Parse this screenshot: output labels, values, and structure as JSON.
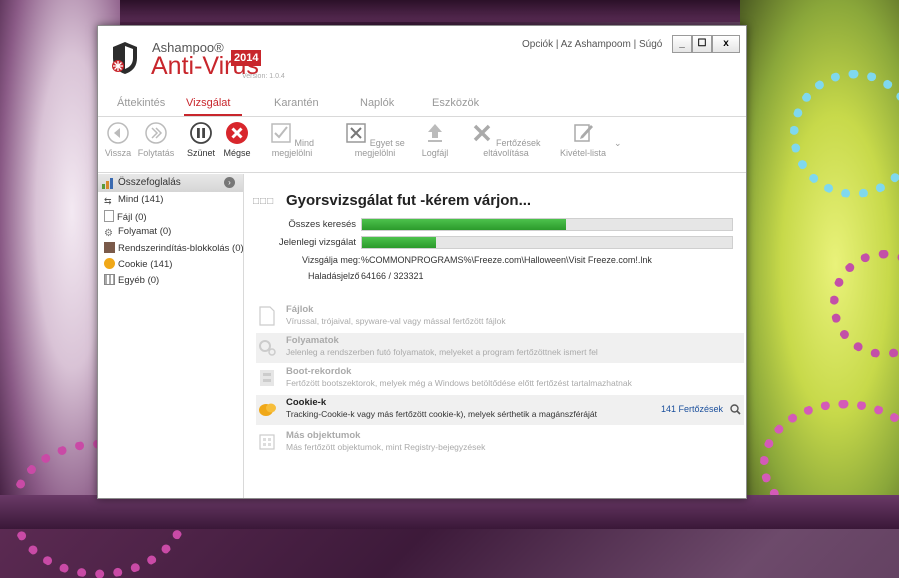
{
  "brand": {
    "company": "Ashampoo®",
    "product": "Anti-Virus",
    "year": "2014",
    "version": "Version: 1.0.4"
  },
  "toplinks": {
    "options": "Opciók",
    "about": "Az Ashampoom",
    "help": "Súgó",
    "sep": "|"
  },
  "window_buttons": {
    "minimize": "_",
    "maximize": "☐",
    "close": "x"
  },
  "tabs": [
    {
      "label": "Áttekintés"
    },
    {
      "label": "Vizsgálat"
    },
    {
      "label": "Karantén"
    },
    {
      "label": "Naplók"
    },
    {
      "label": "Eszközök"
    }
  ],
  "toolbar": {
    "back": "Vissza",
    "resume": "Folytatás",
    "pause": "Szünet",
    "cancel": "Mégse",
    "select_all": "Mind megjelölni",
    "select_none": "Egyet se megjelölni",
    "logfile": "Logfájl",
    "remove": "Fertőzések eltávolítása",
    "exceptions": "Kivétel-lista"
  },
  "sidebar": {
    "header": "Összefoglalás",
    "items": [
      {
        "label": "Mind (141)"
      },
      {
        "label": "Fájl (0)"
      },
      {
        "label": "Folyamat (0)"
      },
      {
        "label": "Rendszerindítás-blokkolás (0)"
      },
      {
        "label": "Cookie (141)"
      },
      {
        "label": "Egyéb (0)"
      }
    ]
  },
  "scan": {
    "title": "Gyorsvizsgálat fut -kérem várjon...",
    "boxes": "□□□",
    "total_label": "Összes keresés",
    "total_progress": 0.55,
    "current_label": "Jelenlegi vizsgálat",
    "current_progress": 0.2,
    "scanning_label": "Vizsgálja meg:",
    "scanning_path": "%COMMONPROGRAMS%\\Freeze.com\\Halloween\\Visit Freeze.com!.lnk",
    "progress_label": "Haladásjelző",
    "progress_value": "64166 / 323321"
  },
  "categories": [
    {
      "title": "Fájlok",
      "desc": "Vírussal, trójaival, spyware-val vagy mással fertőzött fájlok"
    },
    {
      "title": "Folyamatok",
      "desc": "Jelenleg a rendszerben futó folyamatok, melyeket a program fertőzöttnek ismert fel"
    },
    {
      "title": "Boot-rekordok",
      "desc": "Fertőzött bootszektorok, melyek még a  Windows betöltődése előtt fertőzést tartalmazhatnak"
    },
    {
      "title": "Cookie-k",
      "desc": "Tracking-Cookie-k vagy más fertőzött cookie-k), melyek sérthetik a magánszféráját",
      "found": "141 Fertőzések"
    },
    {
      "title": "Más objektumok",
      "desc": "Más fertőzött objektumok, mint Registry-bejegyzések"
    }
  ],
  "colors": {
    "brand_red": "#c8262c",
    "progress_green": "#2ea52e",
    "link_blue": "#1a4f9c"
  }
}
